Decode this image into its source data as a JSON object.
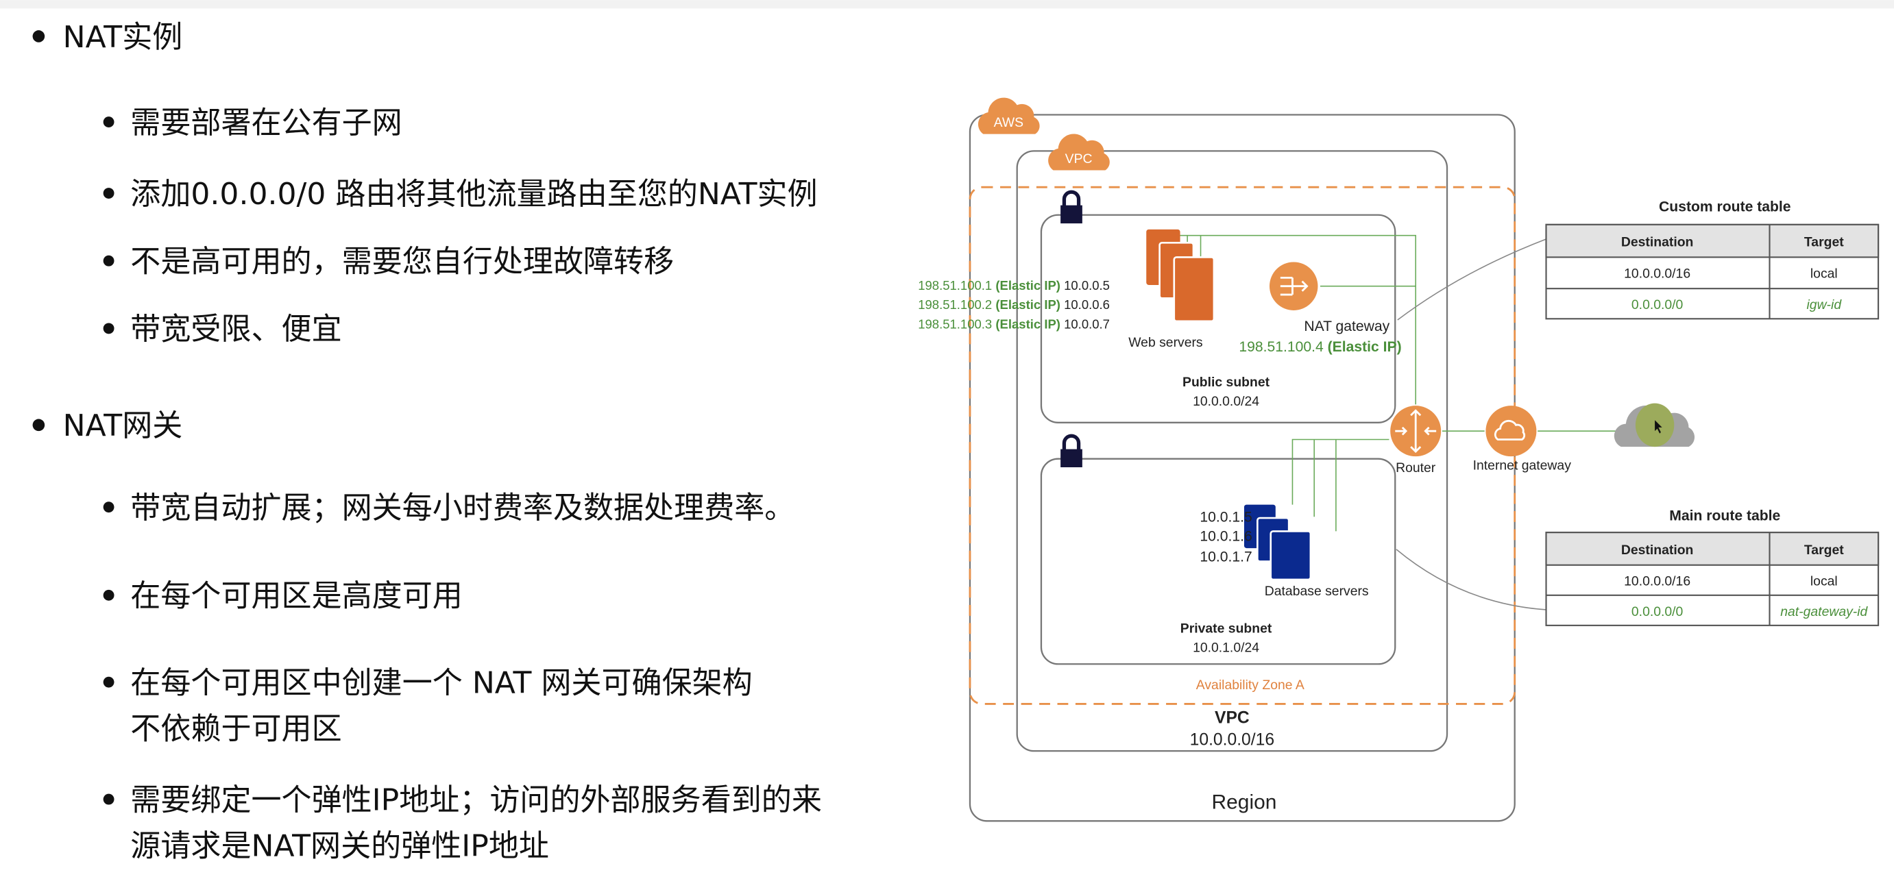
{
  "slide": {
    "sections": [
      {
        "title": "NAT实例",
        "bullets": [
          "需要部署在公有子网",
          "添加0.0.0.0/0 路由将其他流量路由至您的NAT实例",
          "不是高可用的，需要您自行处理故障转移",
          "带宽受限、便宜"
        ]
      },
      {
        "title": "NAT网关",
        "bullets": [
          "带宽自动扩展；网关每小时费率及数据处理费率。",
          "在每个可用区是高度可用",
          "在每个可用区中创建一个 NAT 网关可确保架构",
          "不依赖于可用区",
          "需要绑定一个弹性IP地址；访问的外部服务看到的来",
          "源请求是NAT网关的弹性IP地址"
        ]
      }
    ]
  },
  "diagram": {
    "aws_label": "AWS",
    "vpc_badge": "VPC",
    "az_label": "Availability Zone A",
    "region_label": "Region",
    "vpc_title": "VPC",
    "vpc_cidr": "10.0.0.0/16",
    "public_subnet": {
      "title": "Public subnet",
      "cidr": "10.0.0.0/24",
      "web_servers_label": "Web servers",
      "web_servers": [
        {
          "eip": "198.51.100.1",
          "eip_tag": "(Elastic IP)",
          "ip": "10.0.0.5"
        },
        {
          "eip": "198.51.100.2",
          "eip_tag": "(Elastic IP)",
          "ip": "10.0.0.6"
        },
        {
          "eip": "198.51.100.3",
          "eip_tag": "(Elastic IP)",
          "ip": "10.0.0.7"
        }
      ],
      "nat_label": "NAT gateway",
      "nat_eip": "198.51.100.4",
      "nat_eip_tag": "(Elastic IP)"
    },
    "private_subnet": {
      "title": "Private  subnet",
      "cidr": "10.0.1.0/24",
      "db_label": "Database servers",
      "db_ips": [
        "10.0.1.5",
        "10.0.1.6",
        "10.0.1.7"
      ]
    },
    "router_label": "Router",
    "igw_label": "Internet gateway",
    "custom_route_table": {
      "title": "Custom route table",
      "headers": [
        "Destination",
        "Target"
      ],
      "rows": [
        [
          "10.0.0.0/16",
          "local"
        ],
        [
          "0.0.0.0/0",
          "igw-id"
        ]
      ]
    },
    "main_route_table": {
      "title": "Main route table",
      "headers": [
        "Destination",
        "Target"
      ],
      "rows": [
        [
          "10.0.0.0/16",
          "local"
        ],
        [
          "0.0.0.0/0",
          "nat-gateway-id"
        ]
      ]
    },
    "colors": {
      "orange": "#e8914a",
      "dark_orange": "#d9692c",
      "green": "#4a8f3a",
      "navy": "#0b2a8f",
      "lock": "#14143a"
    }
  }
}
